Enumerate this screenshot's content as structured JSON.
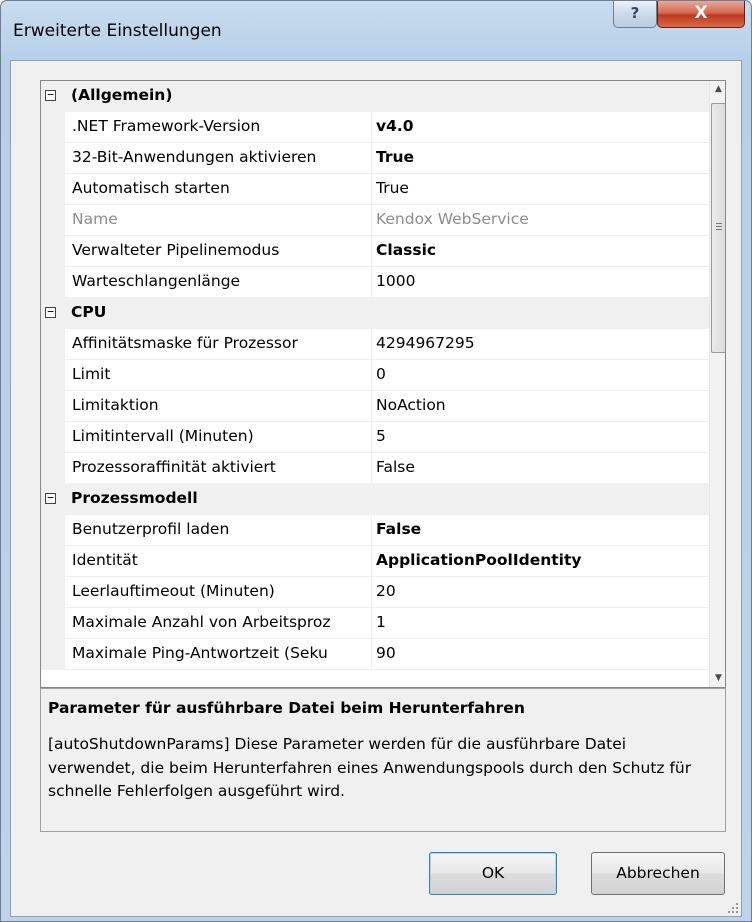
{
  "window": {
    "title": "Erweiterte Einstellungen",
    "help_glyph": "?",
    "close_glyph": "X"
  },
  "grid": {
    "rows": [
      {
        "type": "category",
        "label": "(Allgemein)",
        "expander": "−"
      },
      {
        "type": "prop",
        "name": ".NET Framework-Version",
        "value": "v4.0",
        "bold": true
      },
      {
        "type": "prop",
        "name": "32-Bit-Anwendungen aktivieren",
        "value": "True",
        "bold": true
      },
      {
        "type": "prop",
        "name": "Automatisch starten",
        "value": "True"
      },
      {
        "type": "prop",
        "name": "Name",
        "value": "Kendox WebService",
        "disabled": true
      },
      {
        "type": "prop",
        "name": "Verwalteter Pipelinemodus",
        "value": "Classic",
        "bold": true
      },
      {
        "type": "prop",
        "name": "Warteschlangenlänge",
        "value": "1000"
      },
      {
        "type": "category",
        "label": "CPU",
        "expander": "−"
      },
      {
        "type": "prop",
        "name": "Affinitätsmaske für Prozessor",
        "value": "4294967295"
      },
      {
        "type": "prop",
        "name": "Limit",
        "value": "0"
      },
      {
        "type": "prop",
        "name": "Limitaktion",
        "value": "NoAction"
      },
      {
        "type": "prop",
        "name": "Limitintervall (Minuten)",
        "value": "5"
      },
      {
        "type": "prop",
        "name": "Prozessoraffinität aktiviert",
        "value": "False"
      },
      {
        "type": "category",
        "label": "Prozessmodell",
        "expander": "−"
      },
      {
        "type": "prop",
        "name": "Benutzerprofil laden",
        "value": "False",
        "bold": true
      },
      {
        "type": "prop",
        "name": "Identität",
        "value": "ApplicationPoolIdentity",
        "bold": true
      },
      {
        "type": "prop",
        "name": "Leerlauftimeout (Minuten)",
        "value": "20"
      },
      {
        "type": "prop",
        "name": "Maximale Anzahl von Arbeitsproz",
        "value": "1"
      },
      {
        "type": "prop",
        "name": "Maximale Ping-Antwortzeit (Seku",
        "value": "90"
      }
    ],
    "scroll_up_glyph": "▲",
    "scroll_down_glyph": "▼"
  },
  "description": {
    "title": "Parameter für ausführbare Datei beim Herunterfahren",
    "text": "[autoShutdownParams] Diese Parameter werden für die ausführbare Datei verwendet, die beim Herunterfahren eines Anwendungspools durch den Schutz für schnelle Fehlerfolgen ausgeführt wird."
  },
  "buttons": {
    "ok": "OK",
    "cancel": "Abbrechen"
  }
}
